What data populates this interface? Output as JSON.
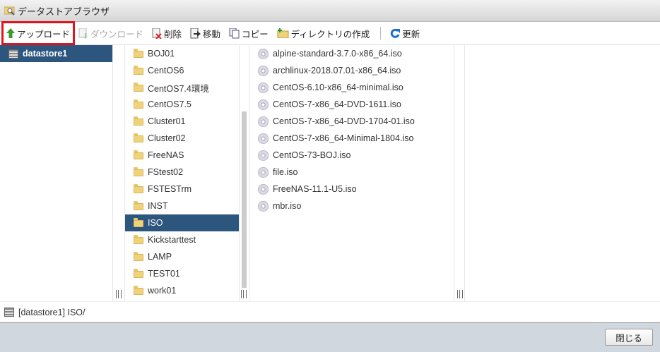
{
  "window": {
    "title": "データストアブラウザ"
  },
  "toolbar": {
    "upload": "アップロード",
    "download": "ダウンロード",
    "delete": "削除",
    "move": "移動",
    "copy": "コピー",
    "mkdir": "ディレクトリの作成",
    "refresh": "更新"
  },
  "datastores": [
    {
      "name": "datastore1",
      "selected": true
    }
  ],
  "folders": [
    {
      "name": "BOJ01"
    },
    {
      "name": "CentOS6"
    },
    {
      "name": "CentOS7.4環境"
    },
    {
      "name": "CentOS7.5"
    },
    {
      "name": "Cluster01"
    },
    {
      "name": "Cluster02"
    },
    {
      "name": "FreeNAS"
    },
    {
      "name": "FStest02"
    },
    {
      "name": "FSTESTrm"
    },
    {
      "name": "INST"
    },
    {
      "name": "ISO",
      "selected": true
    },
    {
      "name": "Kickstarttest"
    },
    {
      "name": "LAMP"
    },
    {
      "name": "TEST01"
    },
    {
      "name": "work01"
    }
  ],
  "files": [
    {
      "name": "alpine-standard-3.7.0-x86_64.iso"
    },
    {
      "name": "archlinux-2018.07.01-x86_64.iso"
    },
    {
      "name": "CentOS-6.10-x86_64-minimal.iso"
    },
    {
      "name": "CentOS-7-x86_64-DVD-1611.iso"
    },
    {
      "name": "CentOS-7-x86_64-DVD-1704-01.iso"
    },
    {
      "name": "CentOS-7-x86_64-Minimal-1804.iso"
    },
    {
      "name": "CentOS-73-BOJ.iso"
    },
    {
      "name": "file.iso"
    },
    {
      "name": "FreeNAS-11.1-U5.iso"
    },
    {
      "name": "mbr.iso"
    }
  ],
  "status": {
    "path": "[datastore1] ISO/"
  },
  "footer": {
    "close": "閉じる"
  }
}
